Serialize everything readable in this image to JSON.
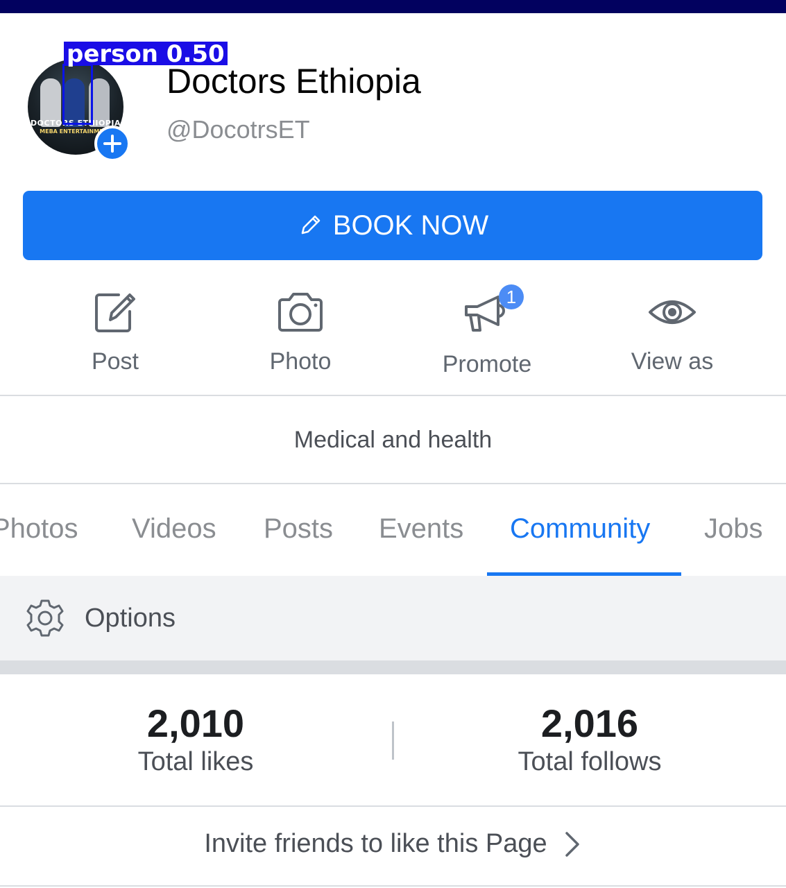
{
  "header": {
    "page_name": "Doctors Ethiopia",
    "handle": "@DocotrsET",
    "avatar_text_line1": "DOCTORS ETHIOPIA",
    "avatar_text_line2": "MEBA ENTERTAINMENT",
    "detection_label": "person 0.50"
  },
  "book_button": {
    "label": "BOOK NOW",
    "icon": "pencil-icon"
  },
  "actions": [
    {
      "label": "Post",
      "icon": "edit-icon"
    },
    {
      "label": "Photo",
      "icon": "camera-icon"
    },
    {
      "label": "Promote",
      "icon": "megaphone-icon",
      "badge": "1"
    },
    {
      "label": "View as",
      "icon": "eye-icon"
    }
  ],
  "category": "Medical and health",
  "tabs": [
    {
      "label": "Photos",
      "active": false
    },
    {
      "label": "Videos",
      "active": false
    },
    {
      "label": "Posts",
      "active": false
    },
    {
      "label": "Events",
      "active": false
    },
    {
      "label": "Community",
      "active": true
    },
    {
      "label": "Jobs",
      "active": false
    }
  ],
  "options": {
    "label": "Options",
    "icon": "gear-icon"
  },
  "stats": {
    "likes": {
      "value": "2,010",
      "caption": "Total likes"
    },
    "follows": {
      "value": "2,016",
      "caption": "Total follows"
    }
  },
  "invite": {
    "label": "Invite friends to like this Page",
    "icon": "chevron-right-icon"
  },
  "colors": {
    "accent": "#1877f2",
    "top_bar": "#02015f",
    "detection_box": "#1a0de6"
  }
}
